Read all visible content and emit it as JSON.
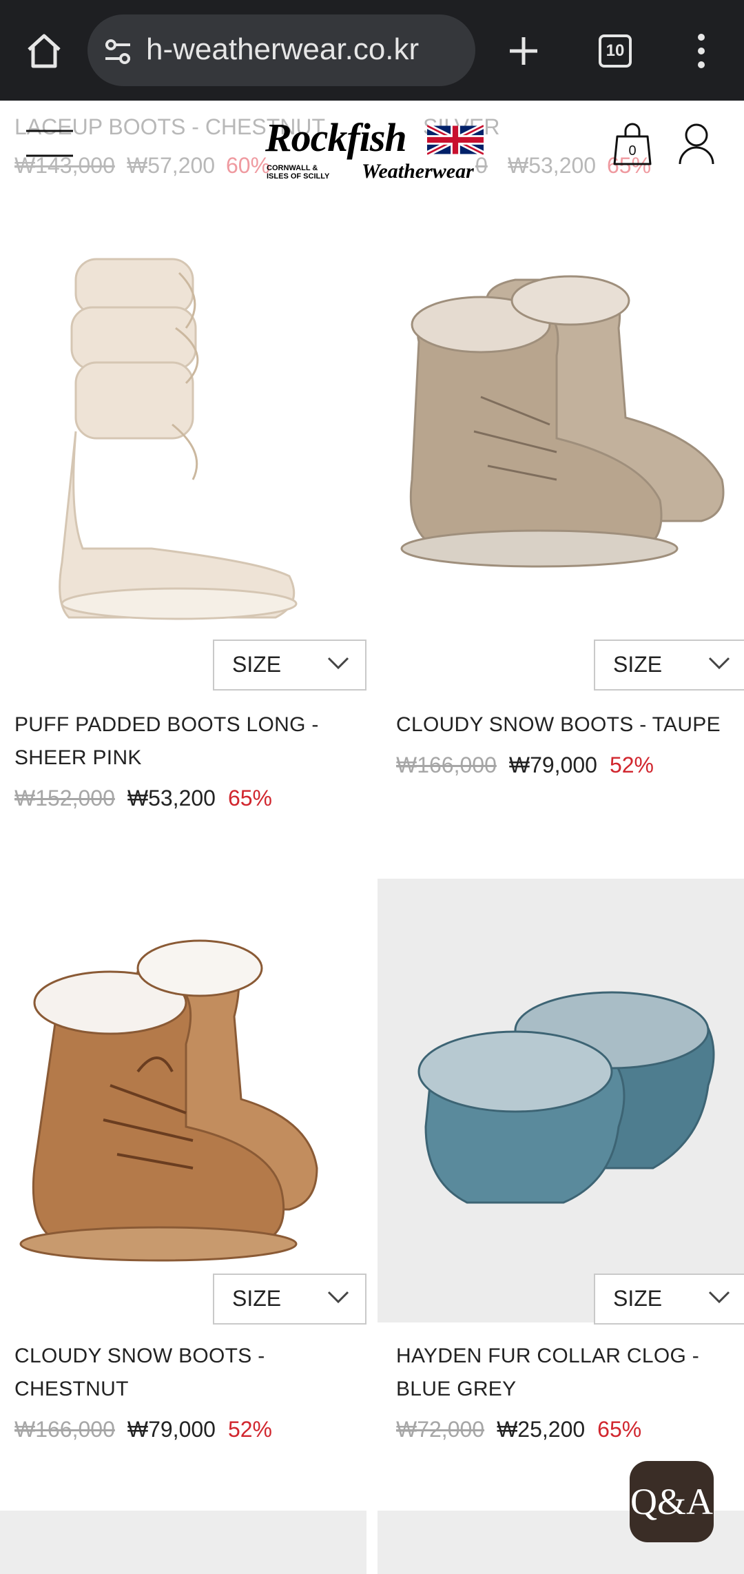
{
  "browser": {
    "url": "h-weatherwear.co.kr",
    "tab_count": "10"
  },
  "header": {
    "cart_count": "0",
    "logo": {
      "brand": "Rockfish",
      "sub": "CORNWALL & ISLES OF SCILLY",
      "tagline": "Weatherwear"
    },
    "behind": {
      "title_left": "LACEUP BOOTS - CHESTNUT",
      "title_right": "SILVER",
      "left": {
        "orig": "₩143,000",
        "sale": "₩57,200",
        "disc": "60%"
      },
      "right": {
        "orig": "0",
        "sale": "₩53,200",
        "disc": "65%"
      }
    }
  },
  "size_label": "SIZE",
  "products": [
    {
      "name_line1": "PUFF PADDED BOOTS LONG -",
      "name_line2": "SHEER PINK",
      "orig": "₩152,000",
      "sale": "₩53,200",
      "disc": "65%"
    },
    {
      "name_line1": "CLOUDY SNOW BOOTS - TAUPE",
      "name_line2": "",
      "orig": "₩166,000",
      "sale": "₩79,000",
      "disc": "52%"
    },
    {
      "name_line1": "CLOUDY SNOW BOOTS -",
      "name_line2": "CHESTNUT",
      "orig": "₩166,000",
      "sale": "₩79,000",
      "disc": "52%"
    },
    {
      "name_line1": "HAYDEN FUR COLLAR CLOG -",
      "name_line2": "BLUE GREY",
      "orig": "₩72,000",
      "sale": "₩25,200",
      "disc": "65%"
    }
  ],
  "qa_button": "Q&A",
  "colors": {
    "discount": "#d1262e",
    "chrome": "#1e1f22"
  }
}
